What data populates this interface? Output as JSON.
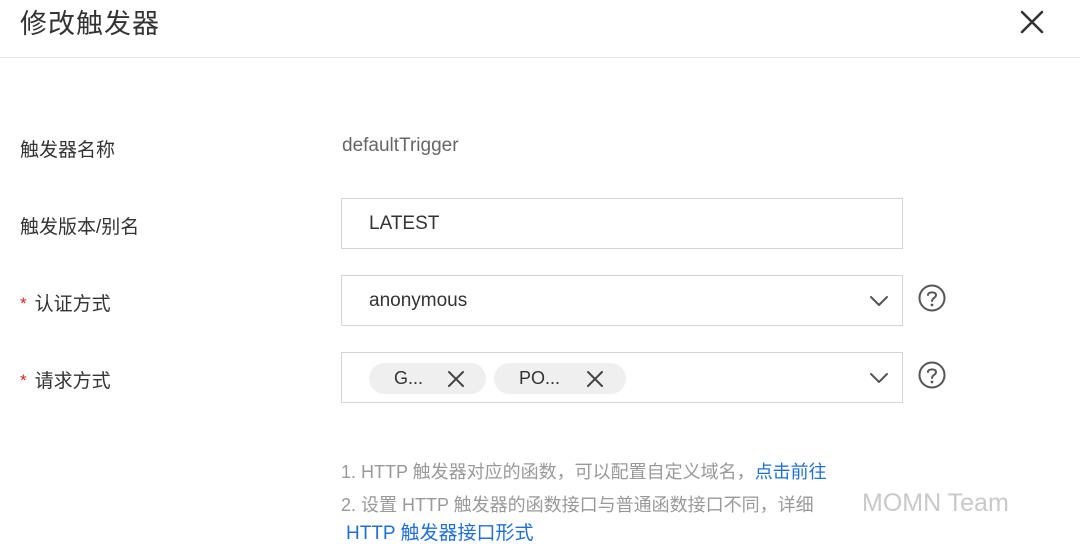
{
  "dialog": {
    "title": "修改触发器"
  },
  "fields": {
    "name": {
      "label": "触发器名称",
      "value": "defaultTrigger"
    },
    "version": {
      "label": "触发版本/别名",
      "value": "LATEST"
    },
    "auth": {
      "required_mark": "*",
      "label": "认证方式",
      "value": "anonymous"
    },
    "methods": {
      "required_mark": "*",
      "label": "请求方式",
      "tags": [
        {
          "label": "G..."
        },
        {
          "label": "PO..."
        }
      ]
    }
  },
  "notes": {
    "line1": "1. HTTP 触发器对应的函数，可以配置自定义域名，",
    "line1_link": "点击前往",
    "line2": "2. 设置 HTTP 触发器的函数接口与普通函数接口不同，详细",
    "line2_link": "HTTP 触发器接口形式"
  },
  "watermark": "MOMN Team"
}
